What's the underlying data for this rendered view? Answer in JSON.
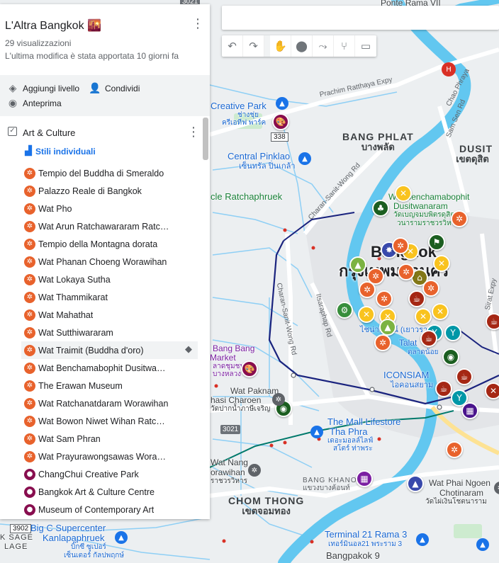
{
  "panel": {
    "title": "L'Altra Bangkok 🌇",
    "views": "29 visualizzazioni",
    "last_modified": "L'ultima modifica è stata apportata 10 giorni fa",
    "actions": {
      "add_layer": "Aggiungi livello",
      "share": "Condividi",
      "preview": "Anteprima"
    },
    "layer": {
      "name": "Art & Culture",
      "styles": "Stili individuali",
      "items": [
        {
          "label": "Tempio del Buddha di Smeraldo",
          "color": "#e8622c",
          "icon": "temple-icon"
        },
        {
          "label": "Palazzo Reale di Bangkok",
          "color": "#e8622c",
          "icon": "temple-icon"
        },
        {
          "label": "Wat Pho",
          "color": "#e8622c",
          "icon": "temple-icon"
        },
        {
          "label": "Wat Arun Ratchawararam Ratchawaramahawihan",
          "color": "#e8622c",
          "icon": "temple-icon"
        },
        {
          "label": "Tempio della Montagna dorata",
          "color": "#e8622c",
          "icon": "temple-icon"
        },
        {
          "label": "Wat Phanan Choeng Worawihan",
          "color": "#e8622c",
          "icon": "temple-icon"
        },
        {
          "label": "Wat Lokaya Sutha",
          "color": "#e8622c",
          "icon": "temple-icon"
        },
        {
          "label": "Wat Thammikarat",
          "color": "#e8622c",
          "icon": "temple-icon"
        },
        {
          "label": "Wat Mahathat",
          "color": "#e8622c",
          "icon": "temple-icon"
        },
        {
          "label": "Wat Sutthiwararam",
          "color": "#e8622c",
          "icon": "temple-icon"
        },
        {
          "label": "Wat Traimit (Buddha d'oro)",
          "color": "#e8622c",
          "icon": "temple-icon",
          "highlighted": true
        },
        {
          "label": "Wat Benchamabophit Dusitwanaram",
          "color": "#e8622c",
          "icon": "temple-icon"
        },
        {
          "label": "The Erawan Museum",
          "color": "#e8622c",
          "icon": "temple-icon"
        },
        {
          "label": "Wat Ratchanatdaram Worawihan",
          "color": "#e8622c",
          "icon": "temple-icon"
        },
        {
          "label": "Wat Bowon Niwet Wihan Ratchaworawihan",
          "color": "#e8622c",
          "icon": "temple-icon"
        },
        {
          "label": "Wat Sam Phran",
          "color": "#e8622c",
          "icon": "temple-icon"
        },
        {
          "label": "Wat Prayurawongsawas Worawihan",
          "color": "#e8622c",
          "icon": "temple-icon"
        },
        {
          "label": "ChangChui Creative Park",
          "color": "#880e4f",
          "icon": "palette-icon"
        },
        {
          "label": "Bangkok Art & Culture Centre",
          "color": "#880e4f",
          "icon": "palette-icon"
        },
        {
          "label": "Museum of Contemporary Art",
          "color": "#880e4f",
          "icon": "palette-icon"
        }
      ]
    }
  },
  "map_labels": {
    "pontesign": "Ponte Rama VII",
    "bang_phlat": "BANG PHLAT",
    "bang_phlat_th": "บางพลัด",
    "dusit": "DUSIT",
    "dusit_th": "เขตดุสิต",
    "creative_park": "Creative Park",
    "creative_park_th1": "ช่างชุ่ย",
    "creative_park_th2": "ครีเอทีฟ พาร์ค",
    "central_pinklao": "Central Pinklao",
    "central_pinklao_th": "เซ็นทรัล ปิ่นเกล้า",
    "ratchaphruek": "cle Ratchaphruek",
    "wat_bench": "Wat Benchamabophit",
    "wat_bench_2": "Dusitwanaram",
    "wat_bench_th1": "วัดเบญจมบพิตรดุสิต",
    "wat_bench_th2": "วนารามราชวรวิหาร",
    "bangkok": "Bangkok",
    "bangkok_th": "กรุงเทพมหานคร",
    "iconsiam": "ICONSIAM",
    "iconsiam_th": "ไอคอนสยาม",
    "bang_bang_market": "Bang Bang",
    "bang_bang_market_2": "Market",
    "bang_bang_th": "ลาดชุมชน",
    "bang_bang_th2": "บางหลวง",
    "wat_paknam": "Wat Paknam",
    "wat_paknam_2": "hasi Charoen",
    "wat_paknam_th": "วัดปากน้ำภาษีเจริญ",
    "mall_lifestore": "The Mall Lifestore",
    "mall_lifestore_2": "Tha Phra",
    "mall_lifestore_th1": "เดอะมอลล์ไลฟ์",
    "mall_lifestore_th2": "สโตร์ ท่าพระ",
    "wat_nang": "Wat Nang",
    "wat_nang_2": "orawihan",
    "wat_nang_th": "ราชวรวิหาร",
    "bang_khanong": "BANG KHANONG",
    "bang_khanong_th": "แขวงบางค้อนท์",
    "wat_phai_ngoen": "Wat Phai Ngoen",
    "wat_phai_ngoen_2": "Chotinaram",
    "wat_phai_ngoen_th": "วัดไผ่เงินโชตนาราม",
    "chom_thong": "CHOM THONG",
    "chom_thong_th": "เขตจอมทอง",
    "big_c": "Big C Supercenter",
    "big_c_2": "Kanlapaphruek",
    "big_c_th1": "บิ๊กซี ซูเปอร์",
    "big_c_th2": "เซ็นเตอร์ กัลปพฤกษ์",
    "terminal21": "Terminal 21 Rama 3",
    "terminal21_th": "เทอร์มินอล21 พระราม 3",
    "bangpakok": "Bangpakok 9",
    "talat": "Talat",
    "talat_th": "ตลาดน้อย",
    "chinatown_th": "ไชน่าทาวน์ (เยาวราช)",
    "kage": "K SAGE",
    "lage": "LAGE",
    "road_prachim": "Prachim Ratthaya Expy",
    "road_charan": "Charan-Sanit-Wong Rd",
    "road_charan2": "Charan-Sanit-Wong Rd",
    "road_itsaraphap": "Itsaraphap Rd",
    "road_chao_phraya": "Chao Phraya",
    "road_sam_sen": "Sam Sen Rd",
    "road_sirat": "Sirat Expy",
    "shield_338": "338",
    "shield_3021": "3021",
    "shield_3021b": "3021",
    "shield_3902": "3902",
    "shield_top": "3021"
  },
  "toolbar": {
    "undo": "↶",
    "redo": "↷",
    "hand": "✋",
    "marker": "⬤",
    "line": "⤳",
    "route": "⑂",
    "ruler": "▭"
  },
  "colors": {
    "temple": "#e8622c",
    "art": "#880e4f",
    "food": "#f9c31f",
    "bar": "#0097a7",
    "shop": "#4a148c",
    "park": "#1b5e20",
    "bike": "#388e3c",
    "coffee": "#a52714",
    "museum": "#f57f17",
    "water": "#aadaff",
    "river": "#62c7f0"
  }
}
